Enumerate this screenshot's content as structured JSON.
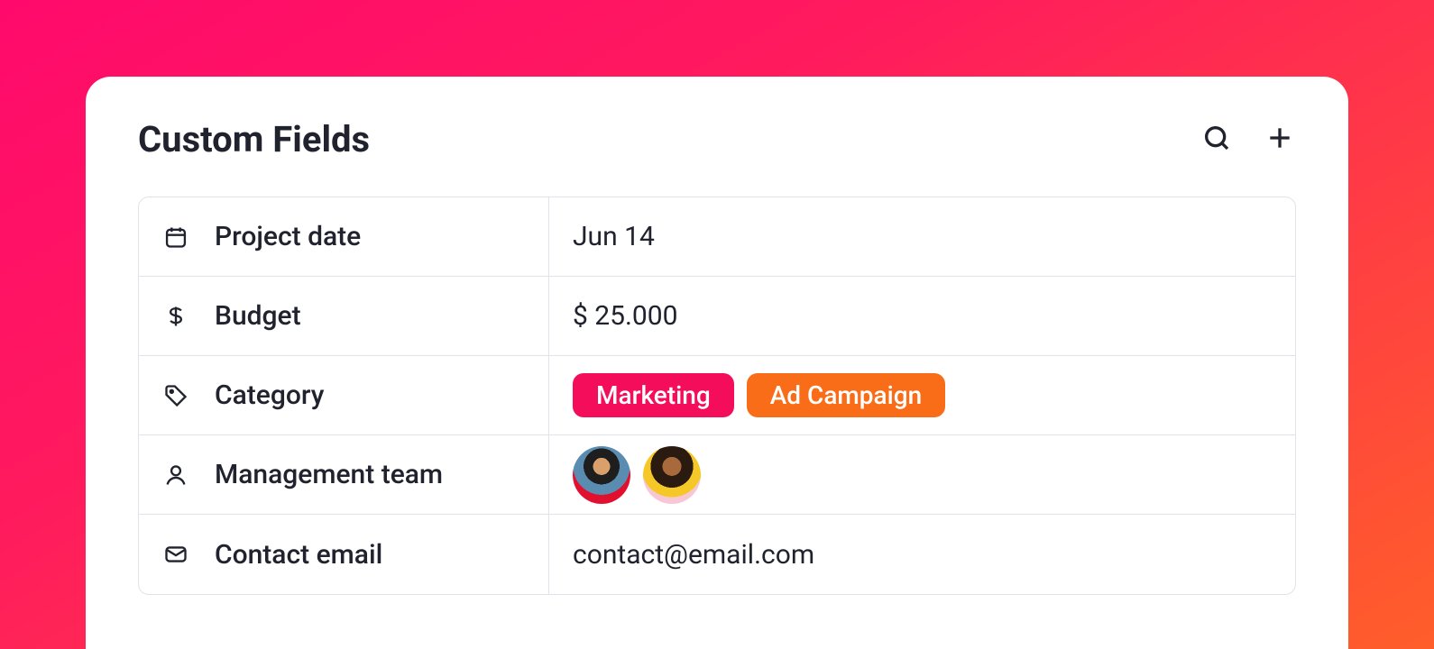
{
  "header": {
    "title": "Custom Fields",
    "actions": {
      "search": "search",
      "add": "add"
    }
  },
  "fields": {
    "project_date": {
      "label": "Project date",
      "value": "Jun 14",
      "icon": "calendar-icon"
    },
    "budget": {
      "label": "Budget",
      "value": "$ 25.000",
      "icon": "dollar-icon"
    },
    "category": {
      "label": "Category",
      "icon": "tag-icon",
      "tags": [
        {
          "label": "Marketing",
          "color": "pink"
        },
        {
          "label": "Ad Campaign",
          "color": "orange"
        }
      ]
    },
    "management": {
      "label": "Management team",
      "icon": "user-icon",
      "members": [
        "Team member 1",
        "Team member 2"
      ]
    },
    "contact_email": {
      "label": "Contact email",
      "value": "contact@email.com",
      "icon": "mail-icon"
    }
  },
  "colors": {
    "pink": "#f40d5a",
    "orange": "#f96d18",
    "text": "#20222e"
  }
}
